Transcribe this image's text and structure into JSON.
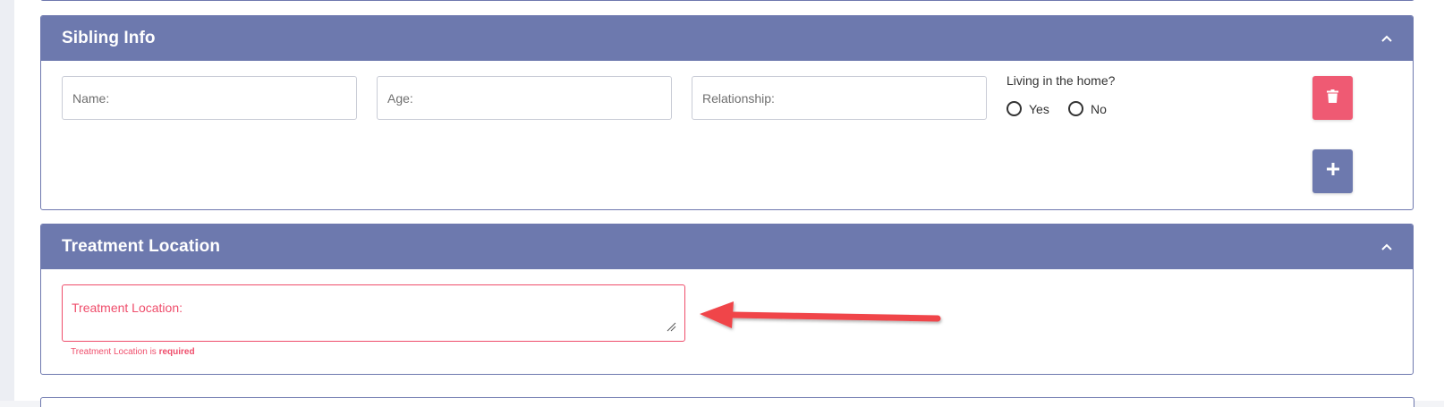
{
  "sibling_card": {
    "title": "Sibling Info",
    "name_placeholder": "Name:",
    "age_placeholder": "Age:",
    "relationship_placeholder": "Relationship:",
    "living_label": "Living in the home?",
    "radio_yes": "Yes",
    "radio_no": "No",
    "icons": {
      "collapse": "chevron-up-icon",
      "delete": "trash-icon",
      "add": "plus-icon"
    }
  },
  "treatment_card": {
    "title": "Treatment Location",
    "field_label": "Treatment Location:",
    "error_prefix": "Treatment Location is ",
    "error_strong": "required",
    "icons": {
      "collapse": "chevron-up-icon",
      "resize": "resize-handle-icon"
    }
  },
  "colors": {
    "header": "#6d79ae",
    "delete_button": "#ef5a73",
    "error": "#ef4d6b",
    "arrow": "#f0444a"
  }
}
